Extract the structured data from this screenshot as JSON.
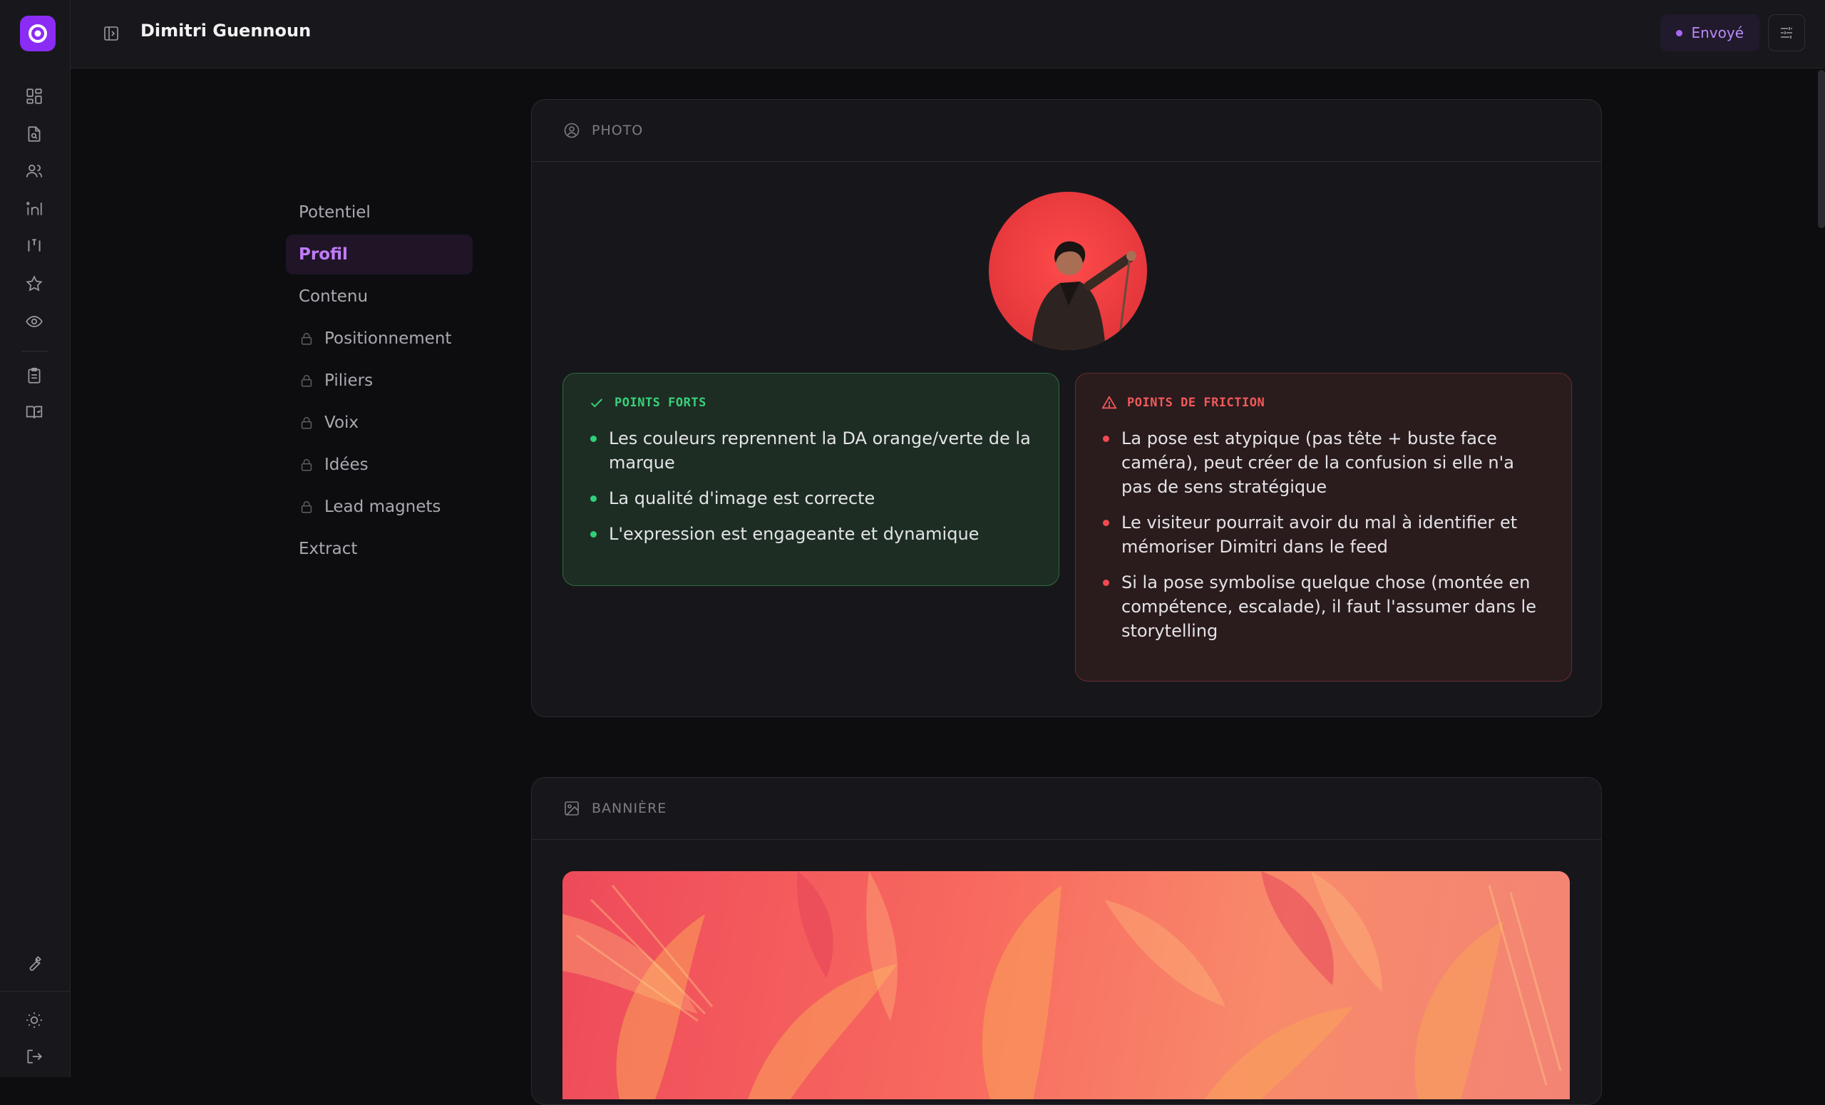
{
  "header": {
    "title": "Dimitri Guennoun",
    "status_label": "Envoyé"
  },
  "rail": {
    "icons": [
      "dashboard-icon",
      "document-search-icon",
      "users-icon",
      "linkedin-icon",
      "columns-icon",
      "star-icon",
      "eye-icon",
      "clipboard-icon",
      "book-icon",
      "wrench-icon",
      "sun-icon",
      "logout-icon"
    ]
  },
  "sections_nav": [
    {
      "label": "Potentiel",
      "locked": false,
      "active": false
    },
    {
      "label": "Profil",
      "locked": false,
      "active": true
    },
    {
      "label": "Contenu",
      "locked": false,
      "active": false
    },
    {
      "label": "Positionnement",
      "locked": true,
      "active": false
    },
    {
      "label": "Piliers",
      "locked": true,
      "active": false
    },
    {
      "label": "Voix",
      "locked": true,
      "active": false
    },
    {
      "label": "Idées",
      "locked": true,
      "active": false
    },
    {
      "label": "Lead magnets",
      "locked": true,
      "active": false
    },
    {
      "label": "Extract",
      "locked": false,
      "active": false
    }
  ],
  "photo_card": {
    "title": "PHOTO",
    "strengths": {
      "title": "POINTS FORTS",
      "items": [
        "Les couleurs reprennent la DA orange/verte de la marque",
        "La qualité d'image est correcte",
        "L'expression est engageante et dynamique"
      ]
    },
    "frictions": {
      "title": "POINTS DE FRICTION",
      "items": [
        "La pose est atypique (pas tête + buste face caméra), peut créer de la confusion si elle n'a pas de sens stratégique",
        "Le visiteur pourrait avoir du mal à identifier et mémoriser Dimitri dans le feed",
        "Si la pose symbolise quelque chose (montée en compétence, escalade), il faut l'assumer dans le storytelling"
      ]
    }
  },
  "banner_card": {
    "title": "BANNIÈRE"
  },
  "colors": {
    "accent": "#8b2cf5",
    "good": "#3ad07c",
    "bad": "#f05a5a"
  }
}
